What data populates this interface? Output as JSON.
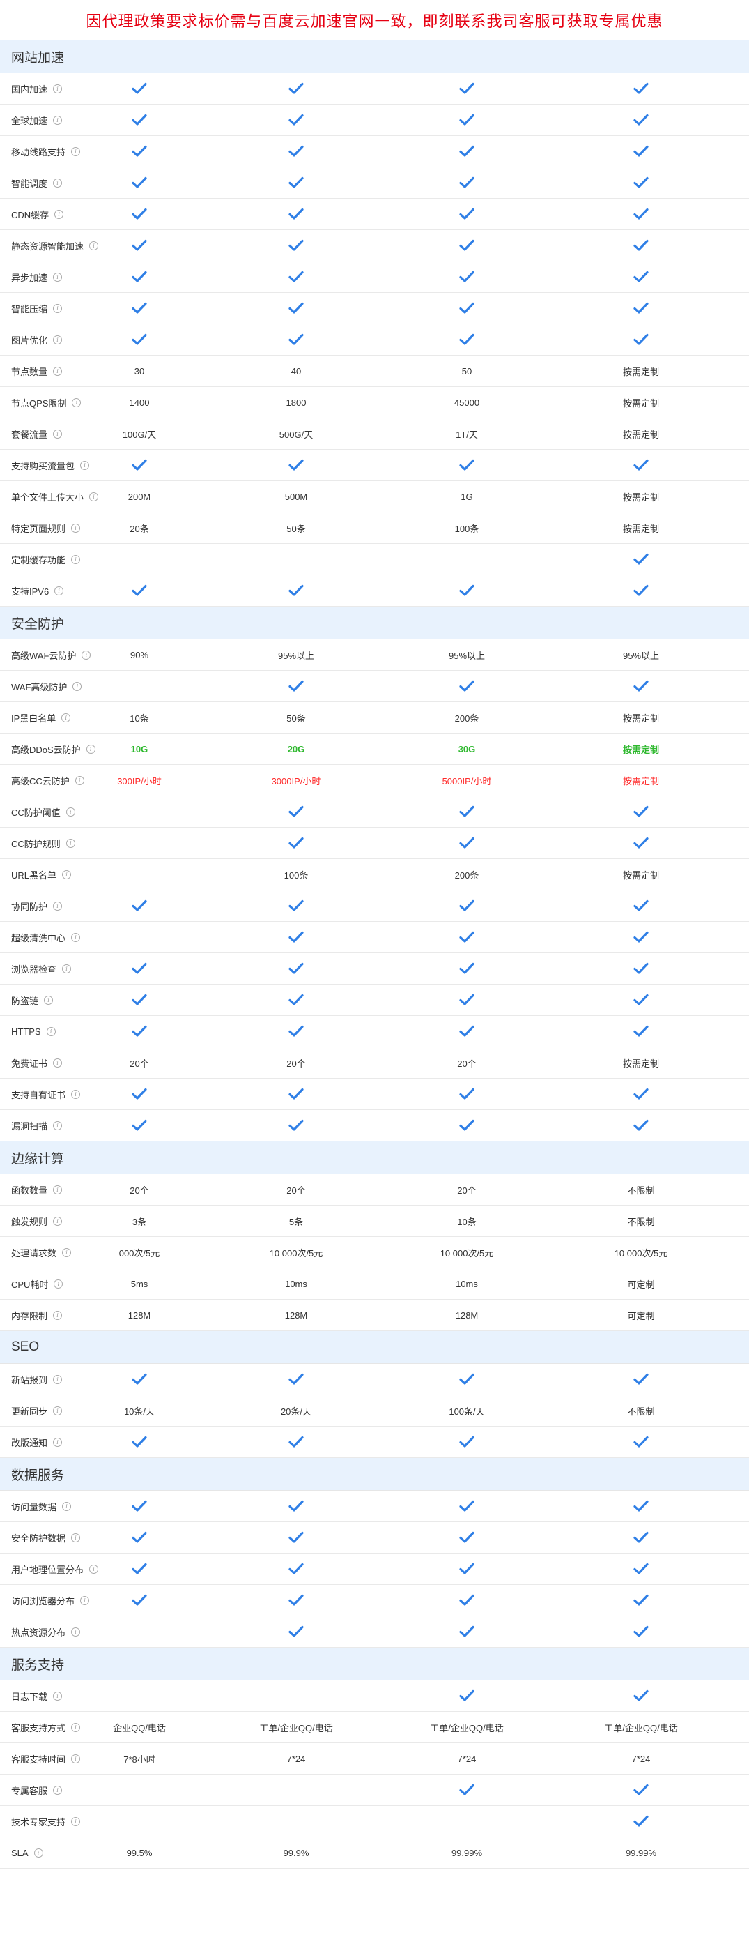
{
  "banner": "因代理政策要求标价需与百度云加速官网一致，即刻联系我司客服可获取专属优惠",
  "colors": {
    "check": "#2f7fe6",
    "section_bg": "#e8f2fd",
    "banner_text": "#e60012",
    "green": "#2eb82e",
    "red": "#ff2a2a"
  },
  "check_icon": "checkmark-icon",
  "info_icon": "info-icon",
  "sections": [
    {
      "title": "网站加速",
      "rows": [
        {
          "name": "国内加速",
          "values": [
            "✓",
            "✓",
            "✓",
            "✓"
          ]
        },
        {
          "name": "全球加速",
          "values": [
            "✓",
            "✓",
            "✓",
            "✓"
          ]
        },
        {
          "name": "移动线路支持",
          "values": [
            "✓",
            "✓",
            "✓",
            "✓"
          ]
        },
        {
          "name": "智能调度",
          "values": [
            "✓",
            "✓",
            "✓",
            "✓"
          ]
        },
        {
          "name": "CDN缓存",
          "values": [
            "✓",
            "✓",
            "✓",
            "✓"
          ]
        },
        {
          "name": "静态资源智能加速",
          "values": [
            "✓",
            "✓",
            "✓",
            "✓"
          ]
        },
        {
          "name": "异步加速",
          "values": [
            "✓",
            "✓",
            "✓",
            "✓"
          ]
        },
        {
          "name": "智能压缩",
          "values": [
            "✓",
            "✓",
            "✓",
            "✓"
          ]
        },
        {
          "name": "图片优化",
          "values": [
            "✓",
            "✓",
            "✓",
            "✓"
          ]
        },
        {
          "name": "节点数量",
          "values": [
            "30",
            "40",
            "50",
            "按需定制"
          ]
        },
        {
          "name": "节点QPS限制",
          "values": [
            "1400",
            "1800",
            "45000",
            "按需定制"
          ]
        },
        {
          "name": "套餐流量",
          "values": [
            "100G/天",
            "500G/天",
            "1T/天",
            "按需定制"
          ]
        },
        {
          "name": "支持购买流量包",
          "values": [
            "✓",
            "✓",
            "✓",
            "✓"
          ]
        },
        {
          "name": "单个文件上传大小",
          "values": [
            "200M",
            "500M",
            "1G",
            "按需定制"
          ]
        },
        {
          "name": "特定页面规则",
          "values": [
            "20条",
            "50条",
            "100条",
            "按需定制"
          ]
        },
        {
          "name": "定制缓存功能",
          "values": [
            "",
            "",
            "",
            "✓"
          ]
        },
        {
          "name": "支持IPV6",
          "values": [
            "✓",
            "✓",
            "✓",
            "✓"
          ]
        }
      ]
    },
    {
      "title": "安全防护",
      "rows": [
        {
          "name": "高级WAF云防护",
          "values": [
            "90%",
            "95%以上",
            "95%以上",
            "95%以上"
          ]
        },
        {
          "name": "WAF高级防护",
          "values": [
            "",
            "✓",
            "✓",
            "✓"
          ]
        },
        {
          "name": "IP黑白名单",
          "values": [
            "10条",
            "50条",
            "200条",
            "按需定制"
          ]
        },
        {
          "name": "高级DDoS云防护",
          "values": [
            "10G",
            "20G",
            "30G",
            "按需定制"
          ],
          "style": "green"
        },
        {
          "name": "高级CC云防护",
          "values": [
            "300IP/小时",
            "3000IP/小时",
            "5000IP/小时",
            "按需定制"
          ],
          "style": "red"
        },
        {
          "name": "CC防护阈值",
          "values": [
            "",
            "✓",
            "✓",
            "✓"
          ]
        },
        {
          "name": "CC防护规则",
          "values": [
            "",
            "✓",
            "✓",
            "✓"
          ]
        },
        {
          "name": "URL黑名单",
          "values": [
            "",
            "100条",
            "200条",
            "按需定制"
          ]
        },
        {
          "name": "协同防护",
          "values": [
            "✓",
            "✓",
            "✓",
            "✓"
          ]
        },
        {
          "name": "超级清洗中心",
          "values": [
            "",
            "✓",
            "✓",
            "✓"
          ]
        },
        {
          "name": "浏览器检查",
          "values": [
            "✓",
            "✓",
            "✓",
            "✓"
          ]
        },
        {
          "name": "防盗链",
          "values": [
            "✓",
            "✓",
            "✓",
            "✓"
          ]
        },
        {
          "name": "HTTPS",
          "values": [
            "✓",
            "✓",
            "✓",
            "✓"
          ]
        },
        {
          "name": "免费证书",
          "values": [
            "20个",
            "20个",
            "20个",
            "按需定制"
          ]
        },
        {
          "name": "支持自有证书",
          "values": [
            "✓",
            "✓",
            "✓",
            "✓"
          ]
        },
        {
          "name": "漏洞扫描",
          "values": [
            "✓",
            "✓",
            "✓",
            "✓"
          ]
        }
      ]
    },
    {
      "title": "边缘计算",
      "rows": [
        {
          "name": "函数数量",
          "values": [
            "20个",
            "20个",
            "20个",
            "不限制"
          ]
        },
        {
          "name": "触发规则",
          "values": [
            "3条",
            "5条",
            "10条",
            "不限制"
          ]
        },
        {
          "name": "处理请求数",
          "values": [
            "000次/5元",
            "10 000次/5元",
            "10 000次/5元",
            "10 000次/5元"
          ]
        },
        {
          "name": "CPU耗时",
          "values": [
            "5ms",
            "10ms",
            "10ms",
            "可定制"
          ]
        },
        {
          "name": "内存限制",
          "values": [
            "128M",
            "128M",
            "128M",
            "可定制"
          ]
        }
      ]
    },
    {
      "title": "SEO",
      "rows": [
        {
          "name": "新站报到",
          "values": [
            "✓",
            "✓",
            "✓",
            "✓"
          ]
        },
        {
          "name": "更新同步",
          "values": [
            "10条/天",
            "20条/天",
            "100条/天",
            "不限制"
          ]
        },
        {
          "name": "改版通知",
          "values": [
            "✓",
            "✓",
            "✓",
            "✓"
          ]
        }
      ]
    },
    {
      "title": "数据服务",
      "rows": [
        {
          "name": "访问量数据",
          "values": [
            "✓",
            "✓",
            "✓",
            "✓"
          ]
        },
        {
          "name": "安全防护数据",
          "values": [
            "✓",
            "✓",
            "✓",
            "✓"
          ]
        },
        {
          "name": "用户地理位置分布",
          "values": [
            "✓",
            "✓",
            "✓",
            "✓"
          ]
        },
        {
          "name": "访问浏览器分布",
          "values": [
            "✓",
            "✓",
            "✓",
            "✓"
          ]
        },
        {
          "name": "热点资源分布",
          "values": [
            "",
            "✓",
            "✓",
            "✓"
          ]
        }
      ]
    },
    {
      "title": "服务支持",
      "rows": [
        {
          "name": "日志下载",
          "values": [
            "",
            "",
            "✓",
            "✓"
          ]
        },
        {
          "name": "客服支持方式",
          "values": [
            "企业QQ/电话",
            "工单/企业QQ/电话",
            "工单/企业QQ/电话",
            "工单/企业QQ/电话"
          ]
        },
        {
          "name": "客服支持时间",
          "values": [
            "7*8小时",
            "7*24",
            "7*24",
            "7*24"
          ]
        },
        {
          "name": "专属客服",
          "values": [
            "",
            "",
            "✓",
            "✓"
          ]
        },
        {
          "name": "技术专家支持",
          "values": [
            "",
            "",
            "",
            "✓"
          ]
        },
        {
          "name": "SLA",
          "values": [
            "99.5%",
            "99.9%",
            "99.99%",
            "99.99%"
          ]
        }
      ]
    }
  ]
}
